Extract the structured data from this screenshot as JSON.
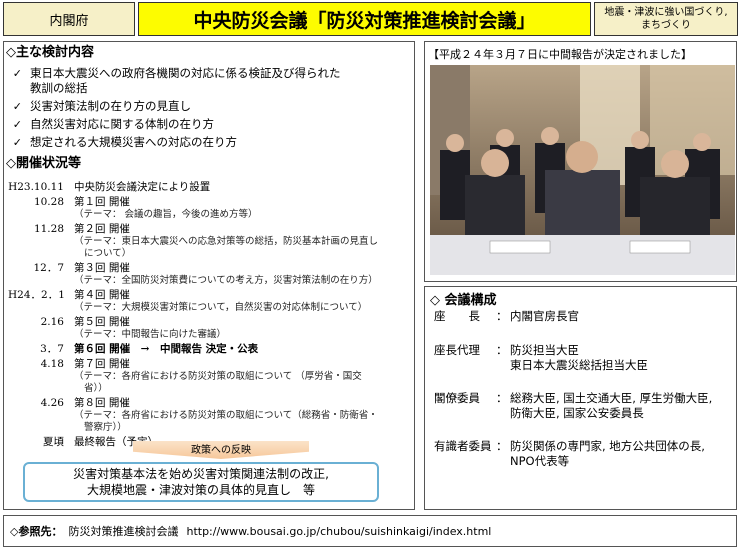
{
  "header": {
    "agency": "内閣府",
    "title": "中央防災会議「防災対策推進検討会議」",
    "tagline_1": "地震・津波に強い国づくり,",
    "tagline_2": "まちづくり"
  },
  "topics": {
    "title": "◇主な検討内容",
    "items": [
      {
        "line1": "東日本大震災への政府各機関の対応に係る検証及び得られた",
        "line2": "教訓の総括"
      },
      {
        "line1": "災害対策法制の在り方の見直し",
        "line2": ""
      },
      {
        "line1": "自然災害対応に関する体制の在り方",
        "line2": ""
      },
      {
        "line1": "想定される大規模災害への対応の在り方",
        "line2": ""
      }
    ]
  },
  "status": {
    "title": "◇開催状況等",
    "rows": [
      {
        "date": "H23.10.11",
        "main": "中央防災会議決定により設置",
        "sub1": "",
        "sub2": ""
      },
      {
        "date": "10.28",
        "main": "第１回 開催",
        "sub1": "（テーマ： 会議の趣旨，今後の進め方等）",
        "sub2": ""
      },
      {
        "date": "11.28",
        "main": "第２回 開催",
        "sub1": "（テーマ：東日本大震災への応急対策等の総括，防災基本計画の見直し",
        "sub2": "について）"
      },
      {
        "date": "12．7",
        "main": "第３回 開催",
        "sub1": "（テーマ：全国防災対策費についての考え方，災害対策法制の在り方）",
        "sub2": ""
      },
      {
        "date": "H24．2．1",
        "main": "第４回 開催",
        "sub1": "（テーマ：大規模災害対策について，自然災害の対応体制について）",
        "sub2": ""
      },
      {
        "date": "2.16",
        "main": "第５回 開催",
        "sub1": "（テーマ：中間報告に向けた審議）",
        "sub2": ""
      },
      {
        "date": "3．7",
        "main": "第６回 開催　→　中間報告 決定・公表",
        "sub1": "",
        "sub2": ""
      },
      {
        "date": "4.18",
        "main": "第７回 開催",
        "sub1": "（テーマ：各府省における防災対策の取組について （厚労省・国交",
        "sub2": "省））"
      },
      {
        "date": "4.26",
        "main": "第８回 開催",
        "sub1": "（テーマ：各府省における防災対策の取組について（総務省・防衛省・",
        "sub2": "警察庁））"
      },
      {
        "date": "夏頃",
        "main": "最終報告（予定）",
        "sub1": "",
        "sub2": ""
      }
    ]
  },
  "feedback_label": "政策への反映",
  "reform": {
    "line1": "災害対策基本法を始め災害対策関連法制の改正,",
    "line2": "大規模地震・津波対策の具体的見直し　等"
  },
  "photo_caption": "【平成２４年３月７日に中間報告が決定されました】",
  "members": {
    "title": "◇ 会議構成",
    "rows": [
      {
        "role": "座　　長",
        "values": [
          "内閣官房長官"
        ]
      },
      {
        "role": "座長代理",
        "values": [
          "防災担当大臣",
          "東日本大震災総括担当大臣"
        ]
      },
      {
        "role": "閣僚委員",
        "values": [
          "総務大臣, 国土交通大臣, 厚生労働大臣,",
          "防衛大臣, 国家公安委員長"
        ]
      },
      {
        "role": "有識者委員",
        "values": [
          "防災関係の専門家, 地方公共団体の長,",
          "NPO代表等"
        ]
      }
    ]
  },
  "reference": {
    "label": "◇参照先：",
    "name": "防災対策推進検討会議",
    "url": "http://www.bousai.go.jp/chubou/suishinkaigi/index.html"
  },
  "colors": {
    "title_bg": "#fdfc00",
    "side_bg": "#f6f0c8",
    "reform_border": "#6ab0d4",
    "feedback_bg": "#f6c79a"
  }
}
